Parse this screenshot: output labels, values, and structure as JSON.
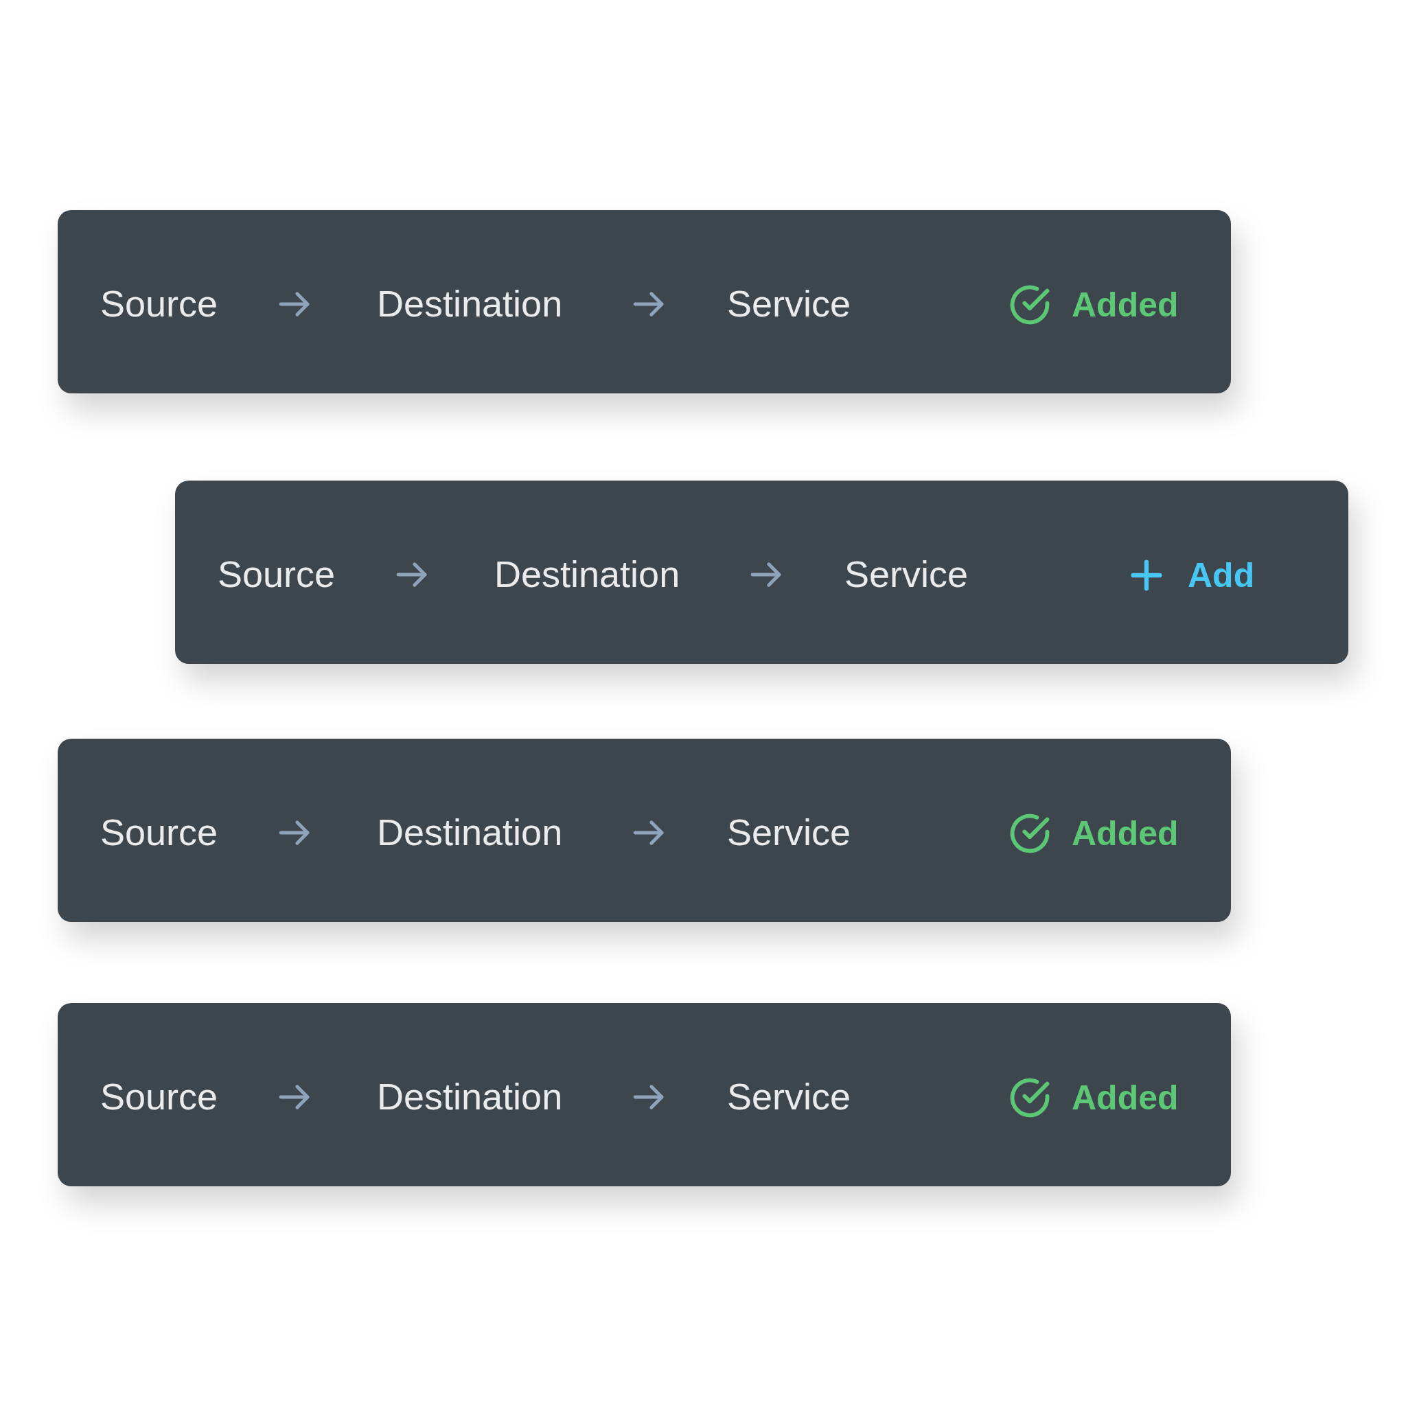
{
  "rows": [
    {
      "steps": [
        "Source",
        "Destination",
        "Service"
      ],
      "status": {
        "kind": "added",
        "label": "Added"
      }
    },
    {
      "steps": [
        "Source",
        "Destination",
        "Service"
      ],
      "status": {
        "kind": "add",
        "label": "Add"
      }
    },
    {
      "steps": [
        "Source",
        "Destination",
        "Service"
      ],
      "status": {
        "kind": "added",
        "label": "Added"
      }
    },
    {
      "steps": [
        "Source",
        "Destination",
        "Service"
      ],
      "status": {
        "kind": "added",
        "label": "Added"
      }
    }
  ]
}
